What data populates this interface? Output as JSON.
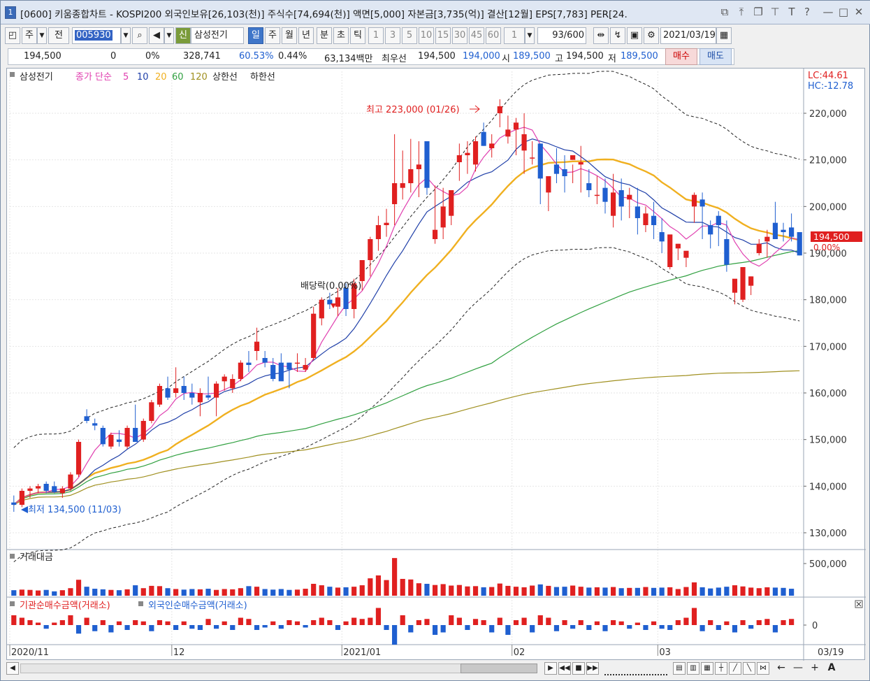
{
  "window": {
    "badge": "1",
    "title": "[0600] 키움종합차트 - KOSPI200 외국인보유[26,103(천)] 주식수[74,694(천)] 액면[5,000] 자본금[3,735(억)] 결산[12월] EPS[7,783] PER[24."
  },
  "toolbar": {
    "period_type": "주",
    "prev_label": "전",
    "code": "005930",
    "sin_label": "신",
    "stock_name": "삼성전기",
    "periods": [
      "일",
      "주",
      "월",
      "년",
      "분",
      "초",
      "틱"
    ],
    "minutes": [
      "1",
      "3",
      "5",
      "10",
      "15",
      "30",
      "45",
      "60"
    ],
    "interval": "1",
    "count": "93",
    "count_max": "/600",
    "date": "2021/03/19"
  },
  "info": {
    "price": "194,500",
    "change": "0",
    "change_pct": "0%",
    "volume": "328,741",
    "ratio1": "60.53%",
    "ratio2": "0.44%",
    "trade_value": "63,134백만",
    "best_label": "최우선",
    "best_sell": "194,500",
    "best_buy": "194,000",
    "open_label": "시",
    "open": "189,500",
    "high_label": "고",
    "high": "194,500",
    "low_label": "저",
    "low": "189,500",
    "buy_btn": "매수",
    "sell_btn": "매도"
  },
  "legend": {
    "name": "삼성전기",
    "ma_label": "종가 단순",
    "ma5": "5",
    "ma10": "10",
    "ma20": "20",
    "ma60": "60",
    "ma120": "120",
    "upper": "상한선",
    "lower": "하한선",
    "lc": "LC:44.61",
    "hc": "HC:-12.78"
  },
  "annotations": {
    "high": "최고 223,000 (01/26)",
    "low": "최저 134,500 (11/03)",
    "dividend": "배당락(0.00%)",
    "current_price": "194,500",
    "current_pct": "0.00%"
  },
  "panels": {
    "volume_title": "거래대금",
    "flow_title1": "기관순매수금액(거래소)",
    "flow_title2": "외국인순매수금액(거래소)"
  },
  "colors": {
    "up": "#e02020",
    "down": "#1f5fd0",
    "ma5": "#e040b0",
    "ma10": "#1f3fa8",
    "ma20": "#f0b020",
    "ma60": "#30a040",
    "ma120": "#a09020",
    "envelope": "#222222"
  },
  "chart_data": {
    "type": "candlestick",
    "y_axis_ticks": [
      "220,000",
      "210,000",
      "200,000",
      "190,000",
      "180,000",
      "170,000",
      "160,000",
      "150,000",
      "140,000",
      "130,000"
    ],
    "ylim": [
      127000,
      226000
    ],
    "x_axis_labels": [
      "2020/11",
      "12",
      "2021/01",
      "02",
      "03"
    ],
    "volume_tick": "500,000",
    "flow_tick": "0",
    "candles": [
      [
        136500,
        138000,
        134500,
        136000
      ],
      [
        136000,
        139500,
        135500,
        139000
      ],
      [
        139000,
        140000,
        137500,
        139500
      ],
      [
        139500,
        140500,
        138500,
        140000
      ],
      [
        140500,
        141000,
        138500,
        139000
      ],
      [
        140000,
        141000,
        138500,
        138800
      ],
      [
        138500,
        140000,
        137500,
        139500
      ],
      [
        139500,
        143000,
        139000,
        142500
      ],
      [
        142500,
        150000,
        142000,
        149500
      ],
      [
        155000,
        156500,
        153500,
        154000
      ],
      [
        153500,
        154500,
        152000,
        153000
      ],
      [
        152500,
        153000,
        148500,
        149000
      ],
      [
        148500,
        151500,
        148000,
        151000
      ],
      [
        150000,
        152000,
        148500,
        149500
      ],
      [
        148500,
        153000,
        148000,
        152500
      ],
      [
        152500,
        157500,
        152000,
        149500
      ],
      [
        150000,
        154500,
        149500,
        154000
      ],
      [
        154000,
        158500,
        153500,
        158000
      ],
      [
        157500,
        162000,
        157000,
        161500
      ],
      [
        161000,
        163500,
        158500,
        159000
      ],
      [
        160000,
        165500,
        159000,
        161000
      ],
      [
        161500,
        163500,
        158500,
        160000
      ],
      [
        160000,
        162000,
        157500,
        159000
      ],
      [
        158000,
        161000,
        155000,
        160000
      ],
      [
        159500,
        163500,
        158500,
        159000
      ],
      [
        159000,
        162500,
        155000,
        162000
      ],
      [
        162500,
        164000,
        160500,
        163500
      ],
      [
        161000,
        164000,
        160000,
        163000
      ],
      [
        163000,
        167000,
        162500,
        166500
      ],
      [
        166500,
        169000,
        164500,
        166000
      ],
      [
        169000,
        174000,
        167000,
        171000
      ],
      [
        167500,
        169000,
        165500,
        166500
      ],
      [
        166000,
        167500,
        162500,
        163000
      ],
      [
        166500,
        168500,
        163000,
        162500
      ],
      [
        166500,
        166500,
        161000,
        165000
      ],
      [
        166500,
        168500,
        164500,
        166500
      ],
      [
        165000,
        167500,
        164500,
        166000
      ],
      [
        167500,
        178500,
        167000,
        177000
      ],
      [
        176000,
        180500,
        174500,
        180000
      ],
      [
        180000,
        181500,
        178000,
        179000
      ],
      [
        178500,
        182500,
        176500,
        180500
      ],
      [
        182500,
        183500,
        176500,
        178000
      ],
      [
        178000,
        184500,
        176000,
        183500
      ],
      [
        184000,
        188000,
        182000,
        188500
      ],
      [
        188500,
        193500,
        185000,
        193000
      ],
      [
        193000,
        198000,
        190500,
        196000
      ],
      [
        196000,
        199500,
        193500,
        196500
      ],
      [
        200500,
        215500,
        196000,
        205000
      ],
      [
        204000,
        212000,
        201500,
        205000
      ],
      [
        205000,
        214500,
        203000,
        208000
      ],
      [
        208000,
        214000,
        202000,
        209000
      ],
      [
        214000,
        211000,
        202500,
        204000
      ],
      [
        193000,
        204500,
        192000,
        195000
      ],
      [
        195500,
        204000,
        193000,
        200000
      ],
      [
        198000,
        203000,
        196000,
        203500
      ],
      [
        209500,
        213500,
        205500,
        211000
      ],
      [
        211000,
        214000,
        207000,
        211500
      ],
      [
        209000,
        215000,
        207500,
        214000
      ],
      [
        216000,
        218000,
        213000,
        213000
      ],
      [
        212500,
        215500,
        210500,
        213500
      ],
      [
        220000,
        223000,
        217000,
        221500
      ],
      [
        215000,
        219500,
        213500,
        216500
      ],
      [
        216500,
        219000,
        211000,
        218000
      ],
      [
        212000,
        220000,
        207000,
        215500
      ],
      [
        210500,
        214000,
        209000,
        210500
      ],
      [
        213500,
        213000,
        200500,
        206000
      ],
      [
        203000,
        206000,
        199000,
        206500
      ],
      [
        209000,
        212500,
        205000,
        207000
      ],
      [
        208000,
        211000,
        203000,
        206500
      ],
      [
        210000,
        209000,
        205000,
        211000
      ],
      [
        209000,
        213000,
        203000,
        209500
      ],
      [
        205000,
        208000,
        202000,
        203500
      ],
      [
        202500,
        206500,
        200500,
        202500
      ],
      [
        204000,
        206000,
        198500,
        201000
      ],
      [
        198000,
        207000,
        195500,
        203000
      ],
      [
        203500,
        206000,
        197000,
        200000
      ],
      [
        201500,
        204000,
        197500,
        202500
      ],
      [
        200000,
        204000,
        194000,
        197500
      ],
      [
        196000,
        200000,
        194500,
        198500
      ],
      [
        198000,
        201000,
        193000,
        196000
      ],
      [
        194500,
        197500,
        190000,
        192500
      ],
      [
        187000,
        190500,
        186500,
        194000
      ],
      [
        191000,
        192000,
        188500,
        192000
      ],
      [
        189000,
        190000,
        187000,
        190500
      ],
      [
        200000,
        203000,
        196500,
        202500
      ],
      [
        201500,
        203000,
        193000,
        200000
      ],
      [
        196000,
        197000,
        191000,
        194000
      ],
      [
        198000,
        199000,
        191500,
        196000
      ],
      [
        193000,
        197000,
        186000,
        187500
      ],
      [
        181500,
        184000,
        179000,
        184500
      ],
      [
        180000,
        187000,
        179500,
        187000
      ],
      [
        183000,
        185000,
        181000,
        185000
      ],
      [
        190000,
        193000,
        189500,
        192000
      ],
      [
        192500,
        195000,
        189000,
        193500
      ],
      [
        196500,
        201000,
        193000,
        193000
      ],
      [
        195000,
        196500,
        192500,
        194500
      ],
      [
        195500,
        198500,
        192500,
        193500
      ],
      [
        194500,
        194500,
        189500,
        189500
      ]
    ],
    "trade_value": [
      38,
      42,
      40,
      36,
      40,
      30,
      38,
      52,
      110,
      62,
      48,
      44,
      40,
      38,
      44,
      72,
      52,
      68,
      66,
      52,
      46,
      42,
      46,
      44,
      48,
      40,
      46,
      44,
      52,
      66,
      62,
      46,
      42,
      46,
      40,
      42,
      48,
      82,
      72,
      62,
      56,
      58,
      62,
      72,
      120,
      140,
      108,
      260,
      116,
      112,
      86,
      82,
      74,
      80,
      70,
      74,
      64,
      66,
      58,
      60,
      84,
      68,
      62,
      58,
      70,
      78,
      68,
      60,
      62,
      70,
      62,
      56,
      58,
      56,
      60,
      52,
      54,
      54,
      60,
      54,
      56,
      58,
      46,
      60,
      92,
      58,
      50,
      56,
      62,
      72,
      64,
      56,
      52,
      58,
      56,
      54,
      48
    ],
    "net_buy": [
      40,
      30,
      20,
      10,
      -15,
      10,
      20,
      40,
      -35,
      30,
      -25,
      20,
      -30,
      15,
      -20,
      20,
      15,
      -25,
      20,
      15,
      -20,
      15,
      -15,
      -20,
      25,
      -15,
      15,
      -20,
      30,
      25,
      -20,
      -10,
      15,
      -15,
      20,
      15,
      -10,
      20,
      30,
      20,
      -20,
      15,
      30,
      25,
      30,
      70,
      -20,
      -80,
      40,
      -30,
      20,
      25,
      -40,
      -30,
      40,
      30,
      -20,
      25,
      20,
      -30,
      30,
      -40,
      20,
      30,
      -30,
      40,
      30,
      -25,
      20,
      -15,
      20,
      -20,
      15,
      -25,
      20,
      15,
      -15,
      10,
      -20,
      15,
      -15,
      -20,
      20,
      30,
      70,
      -25,
      20,
      -20,
      15,
      -30,
      20,
      -15,
      20,
      25,
      -30,
      20,
      25
    ]
  }
}
